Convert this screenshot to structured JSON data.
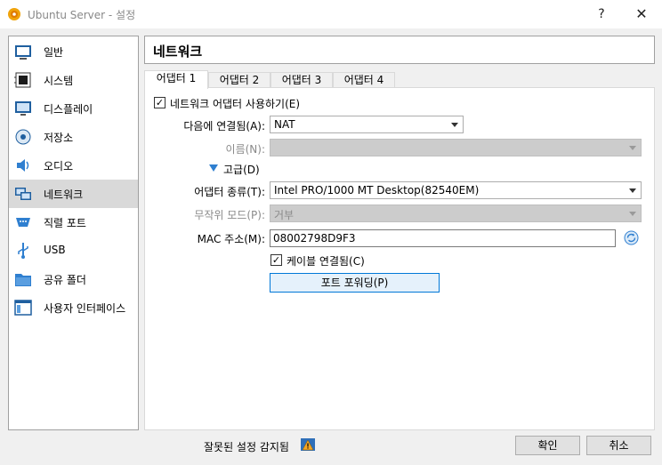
{
  "window": {
    "title": "Ubuntu Server - 설정",
    "help_glyph": "?",
    "close_glyph": "✕"
  },
  "sidebar": {
    "items": [
      {
        "label": "일반",
        "icon": "general-icon"
      },
      {
        "label": "시스템",
        "icon": "system-chip-icon"
      },
      {
        "label": "디스플레이",
        "icon": "display-monitor-icon"
      },
      {
        "label": "저장소",
        "icon": "storage-disk-icon"
      },
      {
        "label": "오디오",
        "icon": "audio-speaker-icon"
      },
      {
        "label": "네트워크",
        "icon": "network-icon"
      },
      {
        "label": "직렬 포트",
        "icon": "serial-port-icon"
      },
      {
        "label": "USB",
        "icon": "usb-icon"
      },
      {
        "label": "공유 폴더",
        "icon": "shared-folder-icon"
      },
      {
        "label": "사용자 인터페이스",
        "icon": "user-interface-icon"
      }
    ],
    "selected_index": 5
  },
  "page": {
    "title": "네트워크",
    "tabs": [
      {
        "label": "어댑터 1"
      },
      {
        "label": "어댑터 2"
      },
      {
        "label": "어댑터 3"
      },
      {
        "label": "어댑터 4"
      }
    ],
    "active_tab": 0
  },
  "adapter": {
    "enable_label": "네트워크 어댑터 사용하기(E)",
    "enable_checked": true,
    "attached_to_label": "다음에 연결됨(A):",
    "attached_to_value": "NAT",
    "name_label": "이름(N):",
    "name_value": "",
    "advanced_label": "고급(D)",
    "adapter_type_label": "어댑터 종류(T):",
    "adapter_type_value": "Intel PRO/1000 MT Desktop(82540EM)",
    "promiscuous_label": "무작위 모드(P):",
    "promiscuous_value": "거부",
    "mac_label": "MAC 주소(M):",
    "mac_value": "08002798D9F3",
    "cable_label": "케이블 연결됨(C)",
    "cable_checked": true,
    "port_forwarding_label": "포트 포워딩(P)"
  },
  "footer": {
    "status_text": "잘못된 설정 감지됨",
    "ok_label": "확인",
    "cancel_label": "취소"
  },
  "colors": {
    "accent": "#0078d7",
    "selected_bg": "#d9d9d9",
    "warning": "#f5a623"
  }
}
